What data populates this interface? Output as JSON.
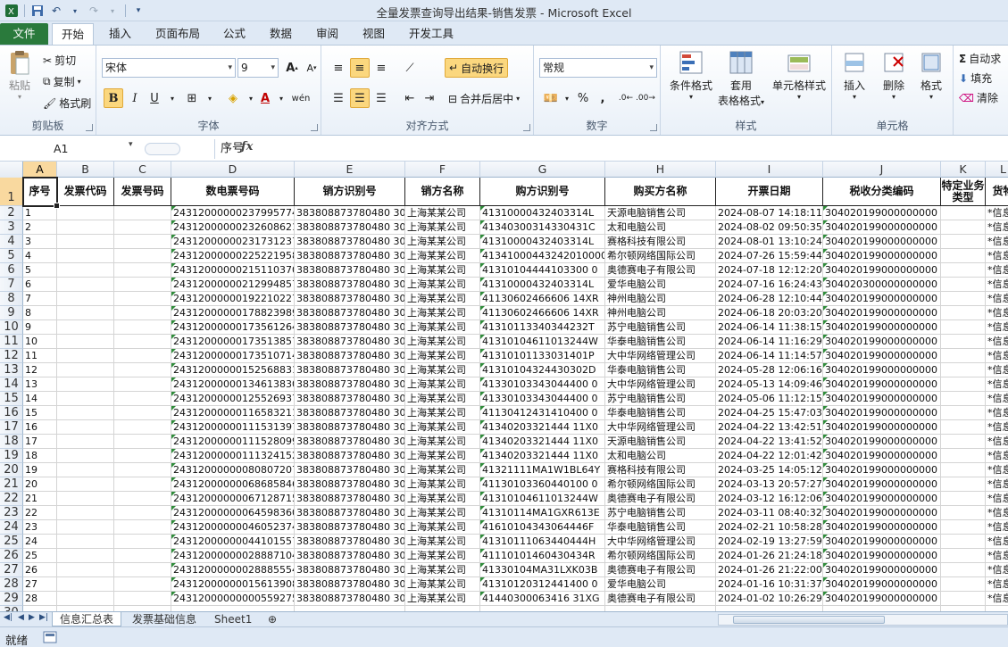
{
  "window": {
    "title": "全量发票查询导出结果-销售发票  -  Microsoft Excel"
  },
  "tabs": [
    "文件",
    "开始",
    "插入",
    "页面布局",
    "公式",
    "数据",
    "审阅",
    "视图",
    "开发工具"
  ],
  "ribbon": {
    "clipboard": {
      "paste": "粘贴",
      "cut": "剪切",
      "copy": "复制",
      "format_painter": "格式刷",
      "label": "剪贴板"
    },
    "font": {
      "name": "宋体",
      "size": "9",
      "label": "字体",
      "bold": "B",
      "italic": "I",
      "underline": "U"
    },
    "alignment": {
      "wrap_text": "自动换行",
      "merge_center": "合并后居中",
      "label": "对齐方式"
    },
    "number": {
      "format": "常规",
      "percent": "%",
      "comma": ",",
      "label": "数字"
    },
    "styles": {
      "conditional": "条件格式",
      "table_line1": "套用",
      "table_line2": "表格格式",
      "cell_styles": "单元格样式",
      "label": "样式"
    },
    "cells": {
      "insert": "插入",
      "delete": "删除",
      "format": "格式",
      "label": "单元格"
    },
    "editing": {
      "autosum": "自动求",
      "fill": "填充",
      "clear": "清除"
    }
  },
  "formula_bar": {
    "name_box": "A1",
    "fx": "fx",
    "value": "序号"
  },
  "columns": [
    "A",
    "B",
    "C",
    "D",
    "E",
    "F",
    "G",
    "H",
    "I",
    "J",
    "K",
    "L"
  ],
  "headers": [
    "序号",
    "发票代码",
    "发票号码",
    "数电票号码",
    "销方识别号",
    "销方名称",
    "购方识别号",
    "购买方名称",
    "开票日期",
    "税收分类编码",
    "特定业务类型",
    "货物"
  ],
  "rows": [
    [
      "1",
      "",
      "",
      "24312000000237995774",
      "383808873780480 30P",
      "上海某某公司",
      "41310000432403314L",
      "天源电脑销售公司",
      "2024-08-07 14:18:11",
      "304020199000000000",
      "",
      "*信息"
    ],
    [
      "2",
      "",
      "",
      "24312000000232608621",
      "383808873780480 30P",
      "上海某某公司",
      "41340300314330431C",
      "太和电脑公司",
      "2024-08-02 09:50:35",
      "304020199000000000",
      "",
      "*信息"
    ],
    [
      "3",
      "",
      "",
      "24312000000231731237",
      "383808873780480 30P",
      "上海某某公司",
      "41310000432403314L",
      "赛格科技有限公司",
      "2024-08-01 13:10:24",
      "304020199000000000",
      "",
      "*信息"
    ],
    [
      "4",
      "",
      "",
      "24312000000225221958",
      "383808873780480 30P",
      "上海某某公司",
      "41341000443242010000",
      "希尔顿网络国际公司",
      "2024-07-26 15:59:44",
      "304020199000000000",
      "",
      "*信息"
    ],
    [
      "5",
      "",
      "",
      "24312000000215110370",
      "383808873780480 30P",
      "上海某某公司",
      "41310104444103300 0",
      "奥德赛电子有限公司",
      "2024-07-18 12:12:20",
      "304020199000000000",
      "",
      "*信息"
    ],
    [
      "6",
      "",
      "",
      "24312000000212994857",
      "383808873780480 30P",
      "上海某某公司",
      "41310000432403314L",
      "爱华电脑公司",
      "2024-07-16 16:24:43",
      "304020300000000000",
      "",
      "*信息"
    ],
    [
      "7",
      "",
      "",
      "24312000000192210227",
      "383808873780480 30P",
      "上海某某公司",
      "41130602466606 14XR",
      "神州电脑公司",
      "2024-06-28 12:10:44",
      "304020199000000000",
      "",
      "*信息"
    ],
    [
      "8",
      "",
      "",
      "24312000000178823989",
      "383808873780480 30P",
      "上海某某公司",
      "41130602466606 14XR",
      "神州电脑公司",
      "2024-06-18 20:03:20",
      "304020199000000000",
      "",
      "*信息"
    ],
    [
      "9",
      "",
      "",
      "24312000000173561264",
      "383808873780480 30P",
      "上海某某公司",
      "41310113340344232T",
      "苏宁电脑销售公司",
      "2024-06-14 11:38:15",
      "304020199000000000",
      "",
      "*信息"
    ],
    [
      "10",
      "",
      "",
      "24312000000173513857",
      "383808873780480 30P",
      "上海某某公司",
      "41310104611013244W",
      "华泰电脑销售公司",
      "2024-06-14 11:16:29",
      "304020199000000000",
      "",
      "*信息"
    ],
    [
      "11",
      "",
      "",
      "24312000000173510714",
      "383808873780480 30P",
      "上海某某公司",
      "41310101133031401P",
      "大中华网络管理公司",
      "2024-06-14 11:14:57",
      "304020199000000000",
      "",
      "*信息"
    ],
    [
      "12",
      "",
      "",
      "24312000000152568831",
      "383808873780480 30P",
      "上海某某公司",
      "41310104324430302D",
      "华泰电脑销售公司",
      "2024-05-28 12:06:16",
      "304020199000000000",
      "",
      "*信息"
    ],
    [
      "13",
      "",
      "",
      "24312000000134613830",
      "383808873780480 30P",
      "上海某某公司",
      "41330103343044400 0",
      "大中华网络管理公司",
      "2024-05-13 14:09:46",
      "304020199000000000",
      "",
      "*信息"
    ],
    [
      "14",
      "",
      "",
      "24312000000125526937",
      "383808873780480 30P",
      "上海某某公司",
      "41330103343044400 0",
      "苏宁电脑销售公司",
      "2024-05-06 11:12:15",
      "304020199000000000",
      "",
      "*信息"
    ],
    [
      "15",
      "",
      "",
      "24312000000116583211",
      "383808873780480 30P",
      "上海某某公司",
      "41130412431410400 0",
      "华泰电脑销售公司",
      "2024-04-25 15:47:03",
      "304020199000000000",
      "",
      "*信息"
    ],
    [
      "16",
      "",
      "",
      "24312000000111531397",
      "383808873780480 30P",
      "上海某某公司",
      "41340203321444 11X0",
      "大中华网络管理公司",
      "2024-04-22 13:42:51",
      "304020199000000000",
      "",
      "*信息"
    ],
    [
      "17",
      "",
      "",
      "24312000000111528099",
      "383808873780480 30P",
      "上海某某公司",
      "41340203321444 11X0",
      "天源电脑销售公司",
      "2024-04-22 13:41:52",
      "304020199000000000",
      "",
      "*信息"
    ],
    [
      "18",
      "",
      "",
      "24312000000111324152",
      "383808873780480 30P",
      "上海某某公司",
      "41340203321444 11X0",
      "太和电脑公司",
      "2024-04-22 12:01:42",
      "304020199000000000",
      "",
      "*信息"
    ],
    [
      "19",
      "",
      "",
      "24312000000080807207",
      "383808873780480 30P",
      "上海某某公司",
      "41321111MA1W1BL64Y",
      "赛格科技有限公司",
      "2024-03-25 14:05:12",
      "304020199000000000",
      "",
      "*信息"
    ],
    [
      "20",
      "",
      "",
      "24312000000068685846",
      "383808873780480 30P",
      "上海某某公司",
      "41130103360440100 0",
      "希尔顿网络国际公司",
      "2024-03-13 20:57:27",
      "304020199000000000",
      "",
      "*信息"
    ],
    [
      "21",
      "",
      "",
      "24312000000067128715",
      "383808873780480 30P",
      "上海某某公司",
      "41310104611013244W",
      "奥德赛电子有限公司",
      "2024-03-12 16:12:06",
      "304020199000000000",
      "",
      "*信息"
    ],
    [
      "22",
      "",
      "",
      "24312000000064598360",
      "383808873780480 30P",
      "上海某某公司",
      "41310114MA1GXR613E",
      "苏宁电脑销售公司",
      "2024-03-11 08:40:32",
      "304020199000000000",
      "",
      "*信息"
    ],
    [
      "23",
      "",
      "",
      "24312000000046052374",
      "383808873780480 30P",
      "上海某某公司",
      "41610104343064446F",
      "华泰电脑销售公司",
      "2024-02-21 10:58:28",
      "304020199000000000",
      "",
      "*信息"
    ],
    [
      "24",
      "",
      "",
      "24312000000044101557",
      "383808873780480 30P",
      "上海某某公司",
      "41310111063440444H",
      "大中华网络管理公司",
      "2024-02-19 13:27:59",
      "304020199000000000",
      "",
      "*信息"
    ],
    [
      "25",
      "",
      "",
      "24312000000028887104",
      "383808873780480 30P",
      "上海某某公司",
      "41110101460430434R",
      "希尔顿网络国际公司",
      "2024-01-26 21:24:18",
      "304020199000000000",
      "",
      "*信息"
    ],
    [
      "26",
      "",
      "",
      "24312000000028885554",
      "383808873780480 30P",
      "上海某某公司",
      "41330104MA31LXK03B",
      "奥德赛电子有限公司",
      "2024-01-26 21:22:00",
      "304020199000000000",
      "",
      "*信息"
    ],
    [
      "27",
      "",
      "",
      "24312000000015613908",
      "383808873780480 30P",
      "上海某某公司",
      "41310120312441400 0",
      "爱华电脑公司",
      "2024-01-16 10:31:37",
      "304020199000000000",
      "",
      "*信息"
    ],
    [
      "28",
      "",
      "",
      "24312000000000559275",
      "383808873780480 30P",
      "上海某某公司",
      "41440300063416 31XG",
      "奥德赛电子有限公司",
      "2024-01-02 10:26:29",
      "304020199000000000",
      "",
      "*信息"
    ]
  ],
  "row_numbers": [
    "1",
    "2",
    "3",
    "4",
    "5",
    "6",
    "7",
    "8",
    "9",
    "10",
    "11",
    "12",
    "13",
    "14",
    "15",
    "16",
    "17",
    "18",
    "19",
    "20",
    "21",
    "22",
    "23",
    "24",
    "25",
    "26",
    "27",
    "28",
    "29",
    "30"
  ],
  "sheets": [
    "信息汇总表",
    "发票基础信息",
    "Sheet1"
  ],
  "status": {
    "ready": "就绪"
  },
  "colors": {
    "file_tab": "#2a7a3c",
    "selected_header": "#f9d99f",
    "ribbon_bg": "#dfe9f5"
  }
}
